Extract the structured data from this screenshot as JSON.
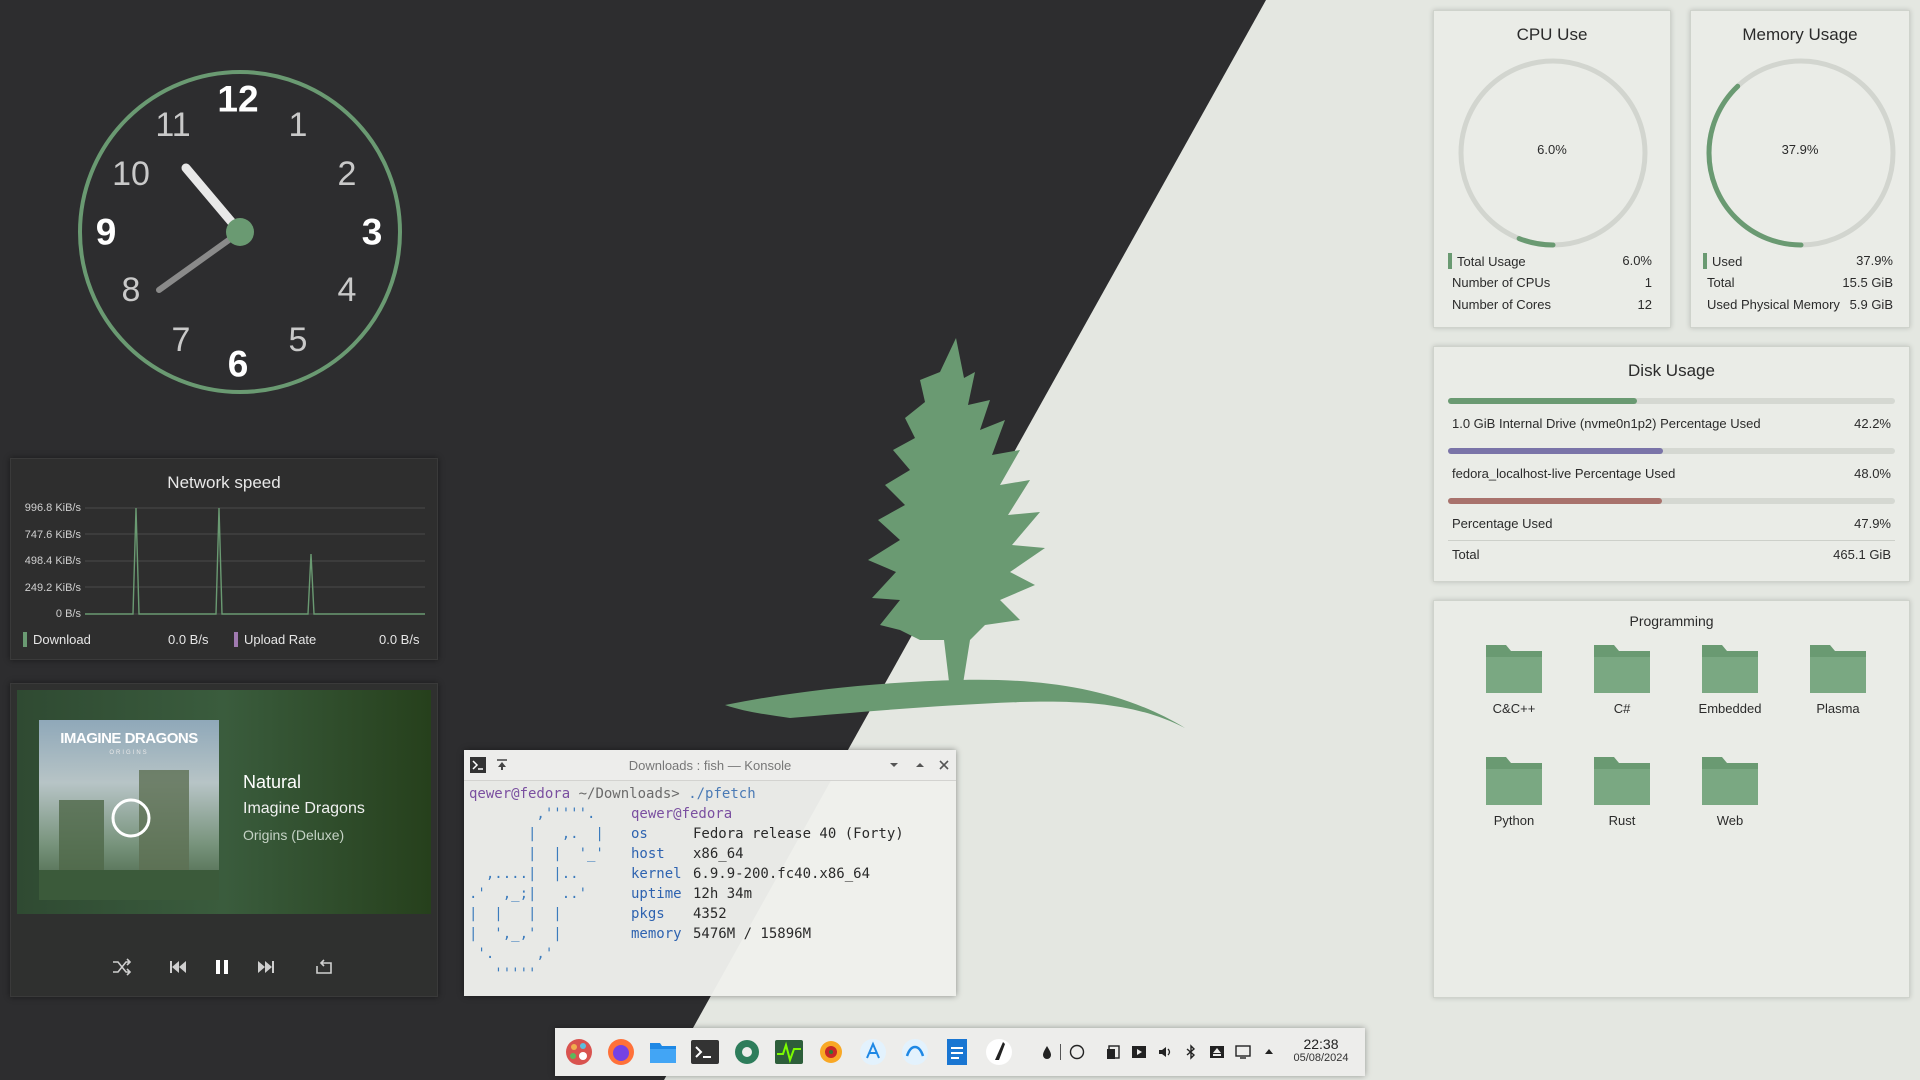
{
  "clock": {
    "numerals": [
      "12",
      "1",
      "2",
      "3",
      "4",
      "5",
      "6",
      "7",
      "8",
      "9",
      "10",
      "11"
    ]
  },
  "network": {
    "title": "Network speed",
    "y_ticks": [
      "996.8 KiB/s",
      "747.6 KiB/s",
      "498.4 KiB/s",
      "249.2 KiB/s",
      "0 B/s"
    ],
    "download_label": "Download",
    "download_value": "0.0 B/s",
    "upload_label": "Upload Rate",
    "upload_value": "0.0 B/s",
    "download_color": "#6a9a72",
    "upload_color": "#a07ab0"
  },
  "player": {
    "track": "Natural",
    "artist": "Imagine Dragons",
    "album": "Origins (Deluxe)",
    "cover_band": "IMAGINE DRAGONS",
    "cover_subtitle": "ORIGINS"
  },
  "konsole": {
    "title": "Downloads : fish — Konsole",
    "prompt_user": "qewer@fedora",
    "prompt_path": "~/Downloads>",
    "command": "./pfetch",
    "info_header": "qewer@fedora",
    "info": [
      {
        "key": "os",
        "value": "Fedora release 40 (Forty)"
      },
      {
        "key": "host",
        "value": "x86_64"
      },
      {
        "key": "kernel",
        "value": "6.9.9-200.fc40.x86_64"
      },
      {
        "key": "uptime",
        "value": "12h 34m"
      },
      {
        "key": "pkgs",
        "value": "4352"
      },
      {
        "key": "memory",
        "value": "5476M / 15896M"
      }
    ],
    "ascii_art": [
      "        ,'''''.",
      "       |   ,.  |",
      "       |  |  '_'",
      "  ,....|  |..",
      ".'  ,_;|   ..'",
      "|  |   |  |",
      "|  ',_,'  |",
      " '.     ,'",
      "   '''''"
    ]
  },
  "cpu": {
    "title": "CPU Use",
    "gauge_text": "6.0%",
    "fraction": 0.06,
    "rows": [
      {
        "label": "Total Usage",
        "value": "6.0%"
      },
      {
        "label": "Number of CPUs",
        "value": "1"
      },
      {
        "label": "Number of Cores",
        "value": "12"
      }
    ]
  },
  "memory": {
    "title": "Memory Usage",
    "gauge_text": "37.9%",
    "fraction": 0.379,
    "rows": [
      {
        "label": "Used",
        "value": "37.9%"
      },
      {
        "label": "Total",
        "value": "15.5 GiB"
      },
      {
        "label": "Used Physical Memory",
        "value": "5.9 GiB"
      }
    ]
  },
  "disk": {
    "title": "Disk Usage",
    "rows": [
      {
        "label": "1.0 GiB Internal Drive (nvme0n1p2) Percentage Used",
        "value": "42.2%",
        "fraction": 0.422,
        "color": "#6a9a72"
      },
      {
        "label": "fedora_localhost-live Percentage Used",
        "value": "48.0%",
        "fraction": 0.48,
        "color": "#7a74a8"
      },
      {
        "label": "Percentage Used",
        "value": "47.9%",
        "fraction": 0.479,
        "color": "#a8726c"
      }
    ],
    "total_label": "Total",
    "total_value": "465.1 GiB"
  },
  "folders": {
    "title": "Programming",
    "items": [
      "C&C++",
      "C#",
      "Embedded",
      "Plasma",
      "Python",
      "Rust",
      "Web"
    ]
  },
  "taskbar": {
    "time": "22:38",
    "date": "05/08/2024",
    "apps": [
      "palette-icon",
      "firefox-icon",
      "file-manager-icon",
      "terminal-icon",
      "settings-icon",
      "system-monitor-icon",
      "media-icon",
      "kdeconnect-icon",
      "kde-icon",
      "document-icon",
      "knife-icon"
    ],
    "tray": [
      "ink-drop-icon",
      "circle-icon",
      "clipboard-icon",
      "media-play-icon",
      "volume-icon",
      "bluetooth-icon",
      "eject-icon",
      "display-icon",
      "expand-arrow-icon"
    ]
  },
  "colors": {
    "accent_green": "#6a9a72",
    "dark_bg": "#2d2d2f",
    "light_bg": "#e4e7e1"
  }
}
